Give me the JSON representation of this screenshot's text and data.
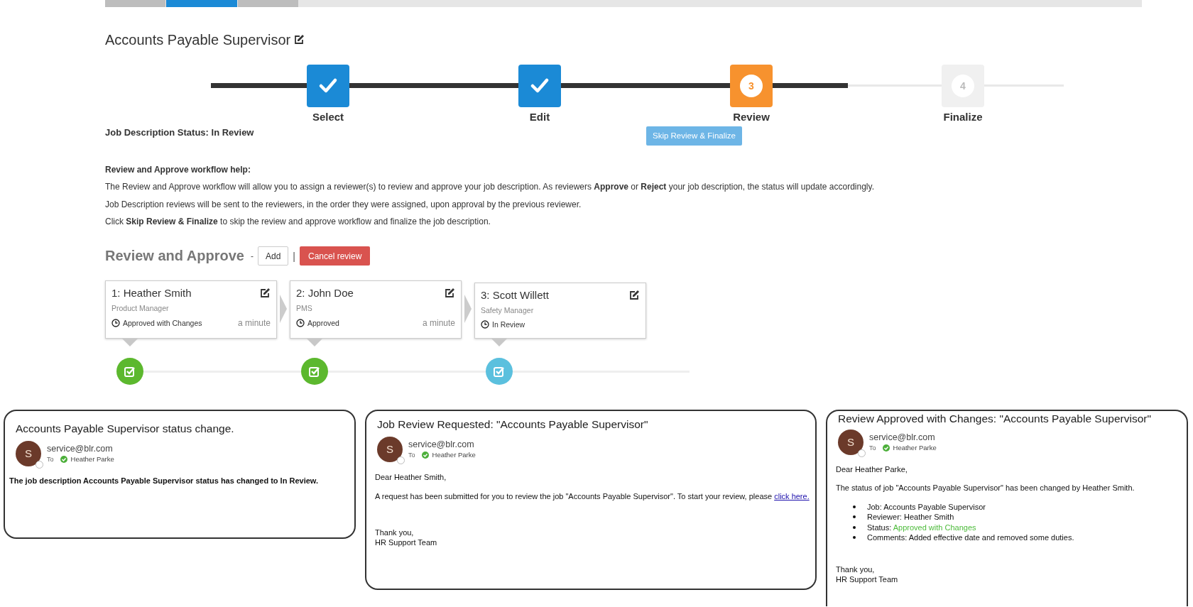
{
  "top_tabs": [
    {
      "selected": false
    },
    {
      "selected": true
    },
    {
      "selected": false
    }
  ],
  "title": "Accounts Payable Supervisor",
  "steps": [
    {
      "label": "Select",
      "completed": true,
      "current": false
    },
    {
      "label": "Edit",
      "completed": true,
      "current": false
    },
    {
      "label": "Review",
      "completed": false,
      "current": true,
      "number": "3"
    },
    {
      "label": "Finalize",
      "completed": false,
      "current": false,
      "number": "4"
    }
  ],
  "status_text": "Job Description Status: In Review",
  "skip_button": "Skip Review & Finalize",
  "help": {
    "heading": "Review and Approve workflow help:",
    "paragraphs": [
      "The Review and Approve workflow will allow you to assign a reviewer(s) to review and approve your job description. As reviewers **Approve** or **Reject** your job description, the status will update accordingly.",
      "Job Description reviews will be sent to the reviewers, in the order they were assigned, upon approval by the previous reviewer.",
      "Click **Skip Review & Finalize** to skip the review and approve workflow and finalize the job description."
    ]
  },
  "review": {
    "heading": "Review and Approve",
    "dash": "-",
    "add_button": "Add",
    "separator": "|",
    "cancel_button": "Cancel review",
    "reviewers": [
      {
        "name": "1: Heather Smith",
        "role": "Product Manager",
        "status": "Approved with Changes",
        "time": "a minute",
        "color": "#5cb82e"
      },
      {
        "name": "2: John Doe",
        "role": "PMS",
        "status": "Approved",
        "time": "a minute",
        "color": "#5cb82e"
      },
      {
        "name": "3: Scott Willett",
        "role": "Safety Manager",
        "status": "In Review",
        "color": "#5bc0de"
      }
    ]
  },
  "emails": [
    {
      "subject": "Accounts Payable Supervisor status change.",
      "avatar": "S",
      "sender": "service@blr.com",
      "to_label": "To",
      "recipient": "Heather Parke",
      "body": [
        {
          "kind": "bold",
          "text": "The job description Accounts Payable Supervisor status has changed to In Review."
        }
      ]
    },
    {
      "subject": "Job Review Requested: \"Accounts Payable Supervisor\"",
      "avatar": "S",
      "sender": "service@blr.com",
      "to_label": "To",
      "recipient": "Heather Parke",
      "body": [
        {
          "kind": "para",
          "text": "Dear Heather Smith,"
        },
        {
          "kind": "para",
          "text": "A request has been submitted for you to review the job \"Accounts Payable Supervisor\". To start your review, please ",
          "link": "click here."
        },
        {
          "kind": "signoff",
          "lines": [
            "Thank you,",
            "HR Support Team"
          ]
        }
      ]
    },
    {
      "subject": "Review Approved with Changes: \"Accounts Payable Supervisor\"",
      "avatar": "S",
      "sender": "service@blr.com",
      "to_label": "To",
      "recipient": "Heather Parke",
      "body": [
        {
          "kind": "para",
          "text": "Dear Heather Parke,"
        },
        {
          "kind": "para",
          "text": "The status of job \"Accounts Payable Supervisor\" has been changed by Heather Smith."
        },
        {
          "kind": "list",
          "items": [
            {
              "text": "Job: Accounts Payable Supervisor"
            },
            {
              "text": "Reviewer: Heather Smith"
            },
            {
              "label": "Status:",
              "value": "Approved with Changes"
            },
            {
              "text": "Comments: Added effective date and removed some duties."
            }
          ]
        },
        {
          "kind": "signoff",
          "lines": [
            "Thank you,",
            "HR Support Team"
          ]
        }
      ]
    }
  ]
}
